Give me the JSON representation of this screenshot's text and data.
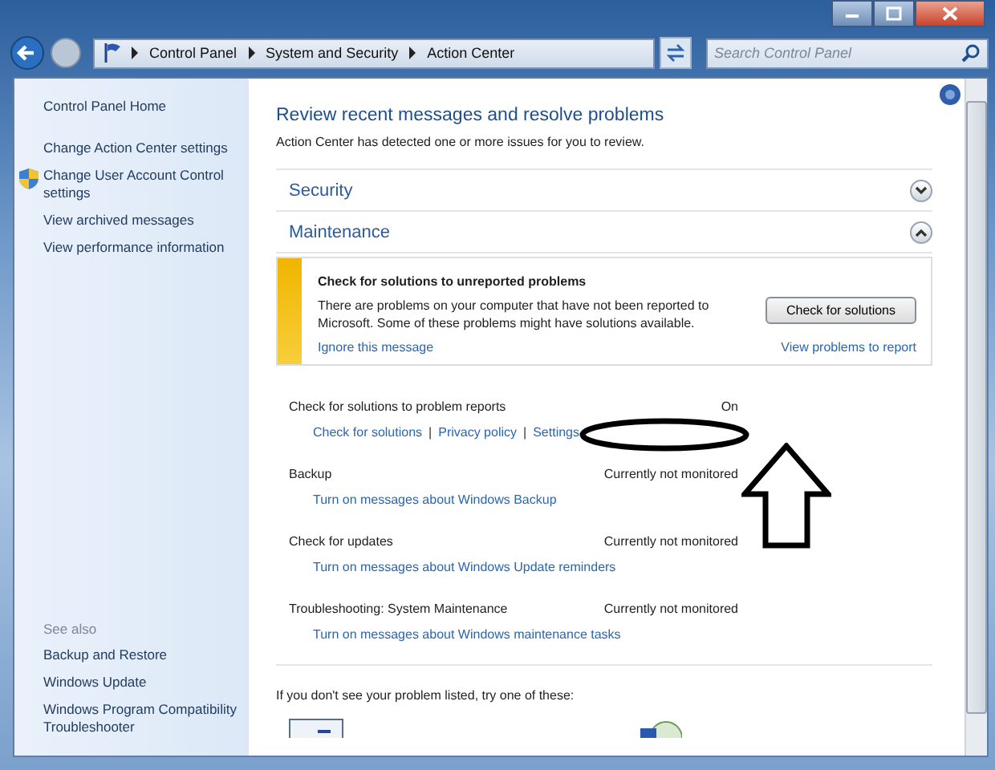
{
  "nav": {
    "breadcrumb": [
      "Control Panel",
      "System and Security",
      "Action Center"
    ],
    "search": {
      "placeholder": "Search Control Panel"
    }
  },
  "sidebar": {
    "links": [
      {
        "label": "Control Panel Home",
        "kind": "home"
      },
      {
        "label": "Change Action Center settings",
        "kind": "link"
      },
      {
        "label": "Change User Account Control settings",
        "kind": "shield"
      },
      {
        "label": "View archived messages",
        "kind": "link"
      },
      {
        "label": "View performance information",
        "kind": "link"
      }
    ],
    "see_also": {
      "heading": "See also",
      "links": [
        "Backup and Restore",
        "Windows Update",
        "Windows Program Compatibility Troubleshooter"
      ]
    }
  },
  "main": {
    "heading": "Review recent messages and resolve problems",
    "subtitle": "Action Center has detected one or more issues for you to review.",
    "sections": [
      {
        "title": "Security",
        "expanded": false
      },
      {
        "title": "Maintenance",
        "expanded": true
      }
    ],
    "alert": {
      "title": "Check for solutions to unreported problems",
      "body": "There are problems on your computer that have not been reported to Microsoft. Some of these problems might have solutions available.",
      "button": "Check for solutions",
      "links": [
        "Ignore this message",
        "View problems to report"
      ]
    },
    "items": [
      {
        "label": "Check for solutions to problem reports",
        "status": "On",
        "separator": "|",
        "links": [
          "Check for solutions",
          "Privacy policy",
          "Settings"
        ]
      },
      {
        "label": "Backup",
        "status": "Currently not monitored",
        "links": [
          "Turn on messages about Windows Backup"
        ]
      },
      {
        "label": "Check for updates",
        "status": "Currently not monitored",
        "links": [
          "Turn on messages about Windows Update reminders"
        ]
      },
      {
        "label": "Troubleshooting: System Maintenance",
        "status": "Currently not monitored",
        "links": [
          "Turn on messages about Windows maintenance tasks"
        ]
      }
    ],
    "footer": "If you don't see your problem listed, try one of these:"
  }
}
